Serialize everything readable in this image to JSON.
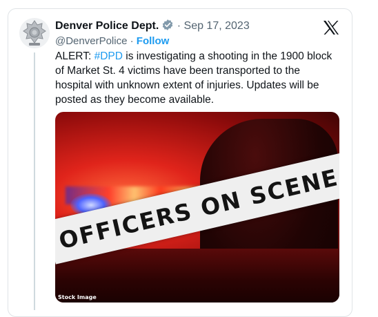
{
  "tweet": {
    "author_name": "Denver Police Dept.",
    "separator": "·",
    "date": "Sep 17, 2023",
    "handle": "@DenverPolice",
    "follow_label": "Follow",
    "text_prefix": "ALERT: ",
    "hashtag": "#DPD",
    "text_suffix": " is investigating a shooting in the 1900 block of Market St. 4 victims have been transported to the hospital with unknown extent of injuries. Updates will be posted as they become available."
  },
  "media": {
    "banner_text": "OFFICERS ON SCENE",
    "caption": "Stock Image"
  },
  "icons": {
    "avatar": "police-badge-icon",
    "verified": "verified-badge-icon",
    "brand": "x-logo-icon"
  },
  "colors": {
    "link": "#1d9bf0",
    "verified_badge": "#829aab",
    "text": "#0f1419",
    "secondary": "#536471"
  }
}
